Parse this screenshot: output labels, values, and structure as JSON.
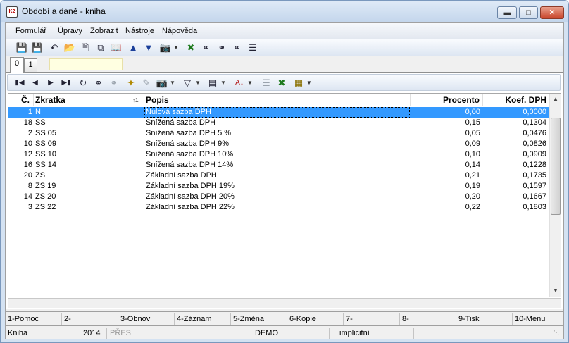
{
  "window": {
    "title": "Období a daně - kniha",
    "app_icon_text": "K2"
  },
  "menu": [
    {
      "label": "Formulář"
    },
    {
      "label": "Úpravy"
    },
    {
      "label": "Zobrazit"
    },
    {
      "label": "Nástroje"
    },
    {
      "label": "Nápověda"
    }
  ],
  "tabs": [
    {
      "label": "0"
    },
    {
      "label": "1"
    }
  ],
  "grid": {
    "columns": {
      "c": "Č.",
      "zkratka": "Zkratka",
      "popis": "Popis",
      "procento": "Procento",
      "koef": "Koef. DPH"
    },
    "sort_indicator": "1",
    "rows": [
      {
        "c": "1",
        "zkratka": "N",
        "popis": "Nulová sazba DPH",
        "procento": "0,00",
        "koef": "0,0000"
      },
      {
        "c": "18",
        "zkratka": "SS",
        "popis": "Snížená sazba DPH",
        "procento": "0,15",
        "koef": "0,1304"
      },
      {
        "c": "2",
        "zkratka": "SS 05",
        "popis": "Snížená sazba DPH 5 %",
        "procento": "0,05",
        "koef": "0,0476"
      },
      {
        "c": "10",
        "zkratka": "SS 09",
        "popis": "Snížená sazba DPH 9%",
        "procento": "0,09",
        "koef": "0,0826"
      },
      {
        "c": "12",
        "zkratka": "SS 10",
        "popis": "Snížená sazba DPH 10%",
        "procento": "0,10",
        "koef": "0,0909"
      },
      {
        "c": "16",
        "zkratka": "SS 14",
        "popis": "Snížená sazba DPH 14%",
        "procento": "0,14",
        "koef": "0,1228"
      },
      {
        "c": "20",
        "zkratka": "ZS",
        "popis": "Základní sazba DPH",
        "procento": "0,21",
        "koef": "0,1735"
      },
      {
        "c": "8",
        "zkratka": "ZS 19",
        "popis": "Základní sazba DPH 19%",
        "procento": "0,19",
        "koef": "0,1597"
      },
      {
        "c": "14",
        "zkratka": "ZS 20",
        "popis": "Základní sazba DPH 20%",
        "procento": "0,20",
        "koef": "0,1667"
      },
      {
        "c": "3",
        "zkratka": "ZS 22",
        "popis": "Základní sazba DPH 22%",
        "procento": "0,22",
        "koef": "0,1803"
      }
    ]
  },
  "function_keys": [
    {
      "label": "1-Pomoc"
    },
    {
      "label": "2-"
    },
    {
      "label": "3-Obnov"
    },
    {
      "label": "4-Záznam"
    },
    {
      "label": "5-Změna"
    },
    {
      "label": "6-Kopie"
    },
    {
      "label": "7-"
    },
    {
      "label": "8-"
    },
    {
      "label": "9-Tisk"
    },
    {
      "label": "10-Menu"
    }
  ],
  "status": {
    "mode": "Kniha",
    "year": "2014",
    "pres": "PŘES",
    "db": "DEMO",
    "param": "implicitní"
  },
  "icons": {
    "save": "save-icon",
    "search": "binoculars-icon",
    "filter": "filter-icon",
    "sort": "sort-az-icon"
  },
  "colors": {
    "selection": "#3399ff",
    "tab_field": "#ffffe1"
  }
}
